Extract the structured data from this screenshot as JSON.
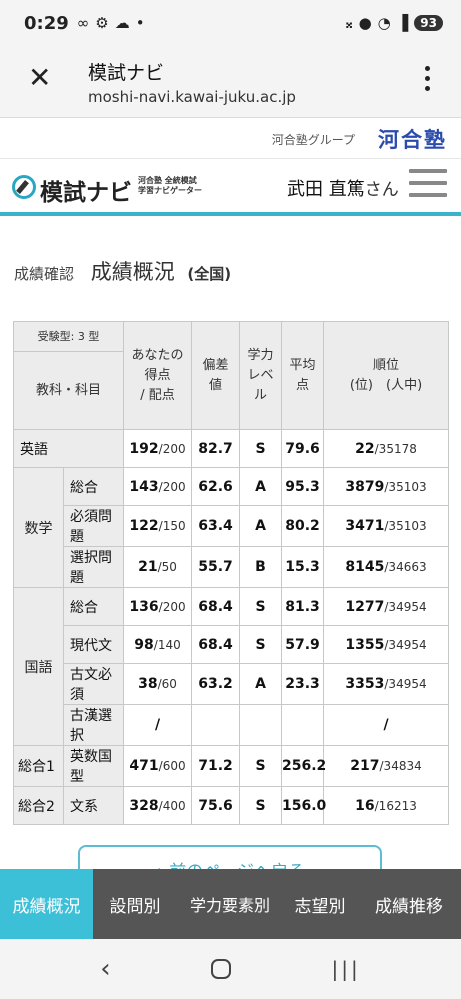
{
  "status": {
    "time": "0:29",
    "left_icons": [
      "link-icon",
      "gear-icon",
      "cloud-icon",
      "dot-icon"
    ],
    "right_icons": [
      "mute-icon",
      "location-icon",
      "wifi-icon",
      "signal-icon"
    ],
    "battery": "93"
  },
  "browser": {
    "title": "模試ナビ",
    "url": "moshi-navi.kawai-juku.ac.jp"
  },
  "group": {
    "label": "河合塾グループ",
    "brand": "河合塾"
  },
  "site": {
    "logo": "模試ナビ",
    "logo_sub1": "河合塾 全統模試",
    "logo_sub2": "学習ナビゲーター",
    "user": "武田 直篤",
    "honorific": "さん"
  },
  "page": {
    "crumb": "成績確認",
    "title": "成績概況",
    "scope": "(全国)"
  },
  "table": {
    "exam_type": "受験型: 3 型",
    "subject_header": "教科・科目",
    "col_score": "あなたの得点/配点",
    "col_score_l1": "あなたの",
    "col_score_l2": "得点",
    "col_score_l3": "/ 配点",
    "col_dev_l1": "偏差",
    "col_dev_l2": "値",
    "col_level_l1": "学力",
    "col_level_l2": "レベ",
    "col_level_l3": "ル",
    "col_avg_l1": "平均",
    "col_avg_l2": "点",
    "col_rank_l1": "順位",
    "col_rank_l2": "(位)　(人中)",
    "english": {
      "label": "英語",
      "score": "192",
      "max": "/200",
      "dev": "82.7",
      "level": "S",
      "avg": "79.6",
      "rank": "22",
      "total": "/35178"
    },
    "math": {
      "label": "数学",
      "rows": [
        {
          "name": "総合",
          "score": "143",
          "max": "/200",
          "dev": "62.6",
          "level": "A",
          "avg": "95.3",
          "rank": "3879",
          "total": "/35103"
        },
        {
          "name": "必須問題",
          "score": "122",
          "max": "/150",
          "dev": "63.4",
          "level": "A",
          "avg": "80.2",
          "rank": "3471",
          "total": "/35103"
        },
        {
          "name": "選択問題",
          "score": "21",
          "max": "/50",
          "dev": "55.7",
          "level": "B",
          "avg": "15.3",
          "rank": "8145",
          "total": "/34663"
        }
      ]
    },
    "japanese": {
      "label": "国語",
      "rows": [
        {
          "name": "総合",
          "score": "136",
          "max": "/200",
          "dev": "68.4",
          "level": "S",
          "avg": "81.3",
          "rank": "1277",
          "total": "/34954"
        },
        {
          "name": "現代文",
          "score": "98",
          "max": "/140",
          "dev": "68.4",
          "level": "S",
          "avg": "57.9",
          "rank": "1355",
          "total": "/34954"
        },
        {
          "name": "古文必須",
          "score": "38",
          "max": "/60",
          "dev": "63.2",
          "level": "A",
          "avg": "23.3",
          "rank": "3353",
          "total": "/34954"
        },
        {
          "name": "古漢選択",
          "score": "/",
          "max": "",
          "dev": "",
          "level": "",
          "avg": "",
          "rank": "/",
          "total": ""
        }
      ]
    },
    "total1": {
      "label": "総合1",
      "name": "英数国型",
      "score": "471",
      "max": "/600",
      "dev": "71.2",
      "level": "S",
      "avg": "256.2",
      "rank": "217",
      "total": "/34834"
    },
    "total2": {
      "label": "総合2",
      "name": "文系",
      "score": "328",
      "max": "/400",
      "dev": "75.6",
      "level": "S",
      "avg": "156.0",
      "rank": "16",
      "total": "/16213"
    }
  },
  "back_button": "←前のページへ戻る",
  "tabs": [
    "成績概況",
    "設問別",
    "学力要素別",
    "志望別",
    "成績推移"
  ],
  "colors": {
    "accent": "#3bc0d8",
    "brand": "#2b4cad",
    "tabbar": "#555555"
  }
}
